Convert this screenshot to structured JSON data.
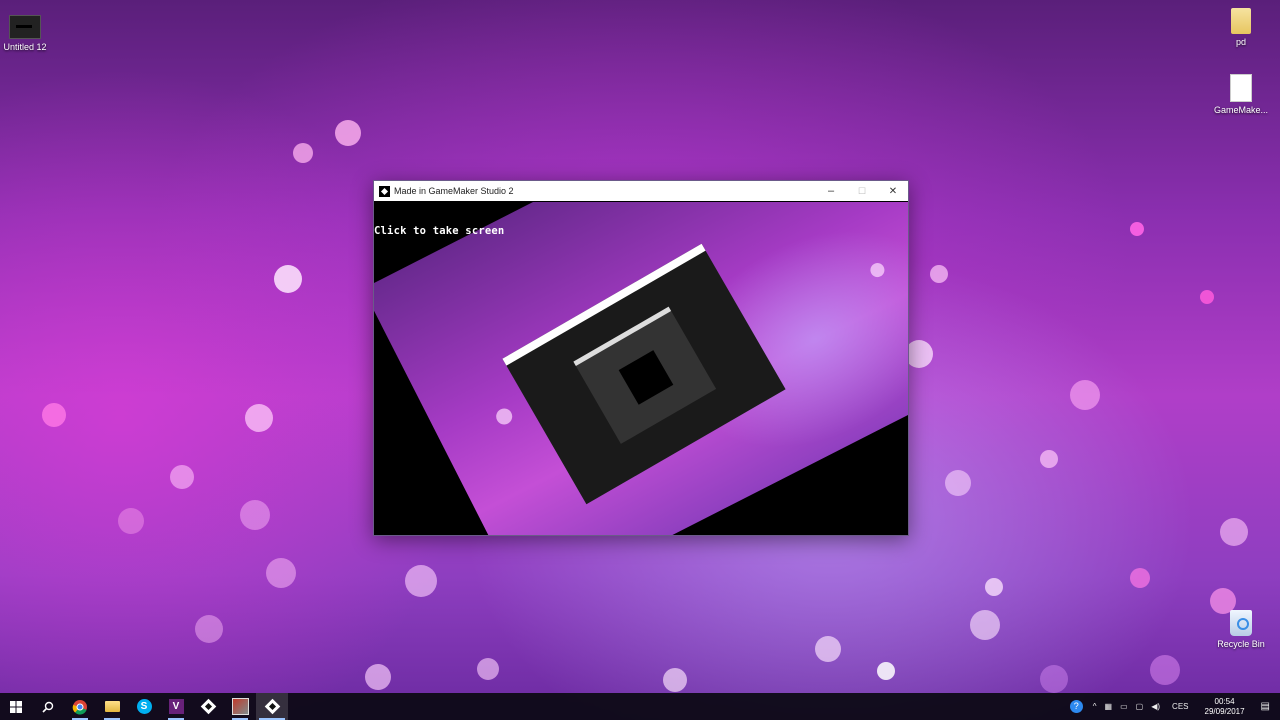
{
  "desktop": {
    "icons": [
      {
        "label": "Untitled 12",
        "icon": "video-file-icon"
      },
      {
        "label": "pd",
        "icon": "folder-icon"
      },
      {
        "label": "GameMake...",
        "icon": "document-icon"
      },
      {
        "label": "Recycle Bin",
        "icon": "recycle-bin-icon"
      }
    ]
  },
  "window": {
    "title": "Made in GameMaker Studio 2",
    "controls": {
      "minimize": "–",
      "maximize": "☐",
      "close": "✕"
    },
    "content_text": "Click to take screen"
  },
  "taskbar": {
    "apps": [
      {
        "name": "start",
        "icon": "windows-start-icon"
      },
      {
        "name": "search",
        "icon": "search-icon"
      },
      {
        "name": "chrome",
        "icon": "chrome-icon"
      },
      {
        "name": "file-explorer",
        "icon": "folder-icon"
      },
      {
        "name": "skype",
        "icon": "skype-icon"
      },
      {
        "name": "visual-studio",
        "icon": "visual-studio-icon"
      },
      {
        "name": "gamemaker",
        "icon": "gamemaker-icon"
      },
      {
        "name": "image-app",
        "icon": "image-app-icon"
      },
      {
        "name": "gamemaker-runner",
        "icon": "gamemaker-icon"
      }
    ],
    "tray": {
      "language": "CES",
      "time": "00:54",
      "date": "29/09/2017"
    }
  }
}
